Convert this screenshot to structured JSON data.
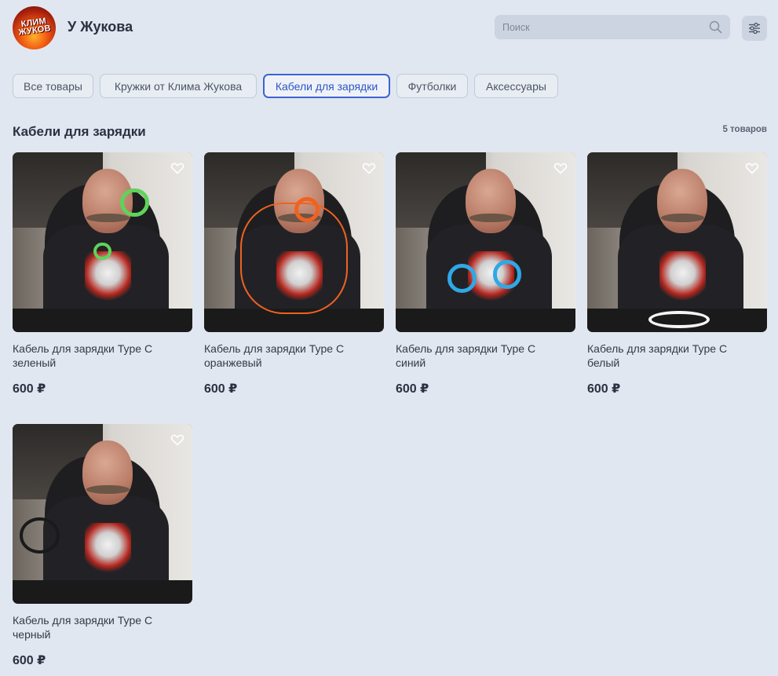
{
  "header": {
    "logo_text": "КЛИМ ЖУКОВ",
    "title": "У Жукова",
    "search_placeholder": "Поиск",
    "search_icon": "search-icon",
    "filter_icon": "sliders-icon"
  },
  "categories": [
    {
      "label": "Все товары",
      "active": false
    },
    {
      "label": "Кружки от Клима Жукова",
      "active": false
    },
    {
      "label": "Кабели для зарядки",
      "active": true
    },
    {
      "label": "Футболки",
      "active": false
    },
    {
      "label": "Аксессуары",
      "active": false
    }
  ],
  "section": {
    "title": "Кабели для зарядки",
    "count": "5 товаров"
  },
  "products": [
    {
      "name_line1": "Кабель для зарядки Type C",
      "name_line2": "зеленый",
      "price": "600 ₽",
      "cable_color": "#5fd35a"
    },
    {
      "name_line1": "Кабель для зарядки Type C",
      "name_line2": "оранжевый",
      "price": "600 ₽",
      "cable_color": "#f0621f"
    },
    {
      "name_line1": "Кабель для зарядки Type C",
      "name_line2": "синий",
      "price": "600 ₽",
      "cable_color": "#2fa8e6"
    },
    {
      "name_line1": "Кабель для зарядки Type C",
      "name_line2": "белый",
      "price": "600 ₽",
      "cable_color": "#f4f4f4"
    },
    {
      "name_line1": "Кабель для зарядки Type C",
      "name_line2": "черный",
      "price": "600 ₽",
      "cable_color": "#1a1a1a"
    }
  ],
  "colors": {
    "background": "#e1e7f0",
    "accent": "#3d63d1",
    "search_bg": "#cbd4e0"
  }
}
